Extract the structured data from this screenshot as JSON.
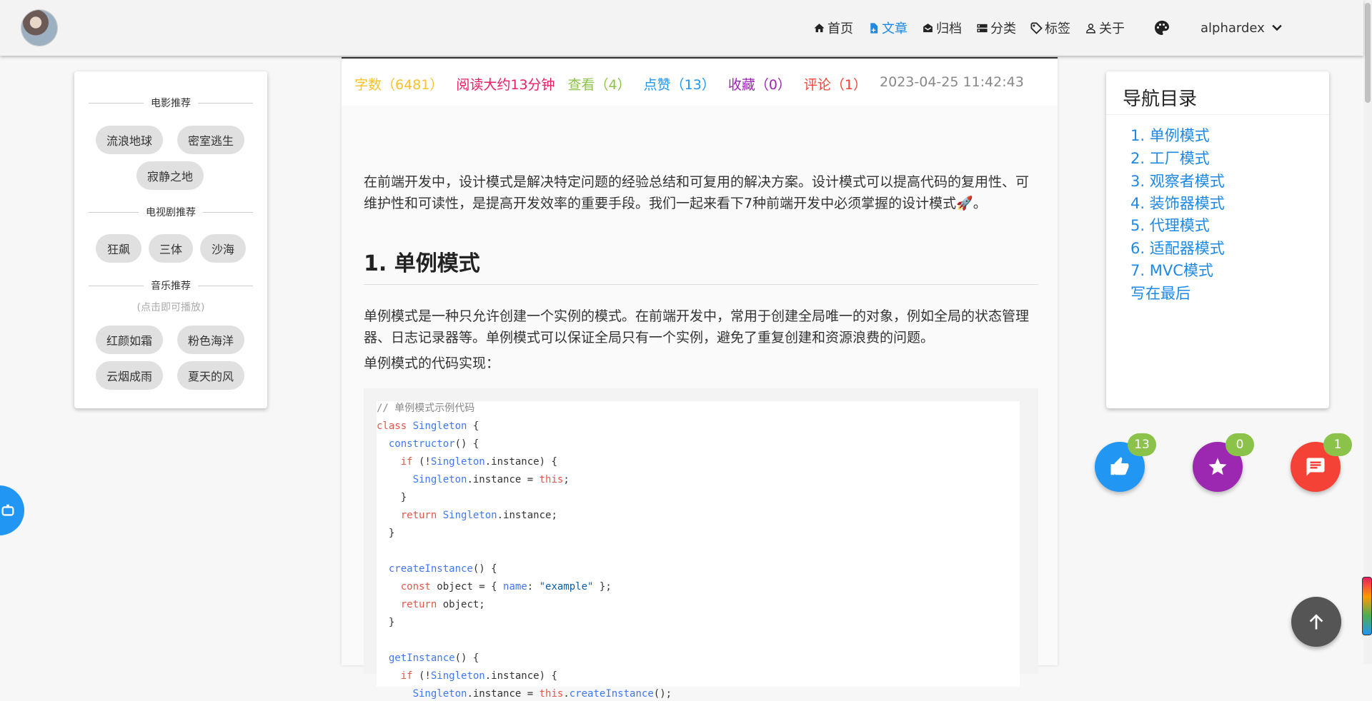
{
  "header": {
    "nav": [
      {
        "label": "首页",
        "icon": "home-icon"
      },
      {
        "label": "文章",
        "icon": "file-icon",
        "active": true
      },
      {
        "label": "归档",
        "icon": "archive-icon"
      },
      {
        "label": "分类",
        "icon": "category-icon"
      },
      {
        "label": "标签",
        "icon": "tag-icon"
      },
      {
        "label": "关于",
        "icon": "person-icon"
      }
    ],
    "theme_icon": "palette-icon",
    "user": "alphardex"
  },
  "sidebar": {
    "movies_title": "电影推荐",
    "movies": [
      "流浪地球",
      "密室逃生",
      "寂静之地"
    ],
    "tv_title": "电视剧推荐",
    "tv": [
      "狂飙",
      "三体",
      "沙海"
    ],
    "music_title": "音乐推荐",
    "music_hint": "(点击即可播放)",
    "music": [
      "红颜如霜",
      "粉色海洋",
      "云烟成雨",
      "夏天的风"
    ]
  },
  "article": {
    "meta": {
      "words": "字数（6481）",
      "read_time": "阅读大约13分钟",
      "views": "查看（4）",
      "likes": "点赞（13）",
      "favorites": "收藏（0）",
      "comments": "评论（1）",
      "date": "2023-04-25 11:42:43"
    },
    "intro": "在前端开发中，设计模式是解决特定问题的经验总结和可复用的解决方案。设计模式可以提高代码的复用性、可维护性和可读性，是提高开发效率的重要手段。我们一起来看下7种前端开发中必须掌握的设计模式🚀。",
    "h1": "1. 单例模式",
    "p1": "单例模式是一种只允许创建一个实例的模式。在前端开发中，常用于创建全局唯一的对象，例如全局的状态管理器、日志记录器等。单例模式可以保证全局只有一个实例，避免了重复创建和资源浪费的问题。",
    "p2": "单例模式的代码实现：",
    "code_comment": "// 单例模式示例代码"
  },
  "toc": {
    "title": "导航目录",
    "items": [
      "1. 单例模式",
      "2. 工厂模式",
      "3. 观察者模式",
      "4. 装饰器模式",
      "5. 代理模式",
      "6. 适配器模式",
      "7. MVC模式",
      "写在最后"
    ]
  },
  "actions": {
    "like_count": "13",
    "star_count": "0",
    "comment_count": "1",
    "colors": {
      "like": "#2196f3",
      "star": "#9c27b0",
      "comment": "#f44336",
      "badge": "#8bc34a"
    }
  }
}
